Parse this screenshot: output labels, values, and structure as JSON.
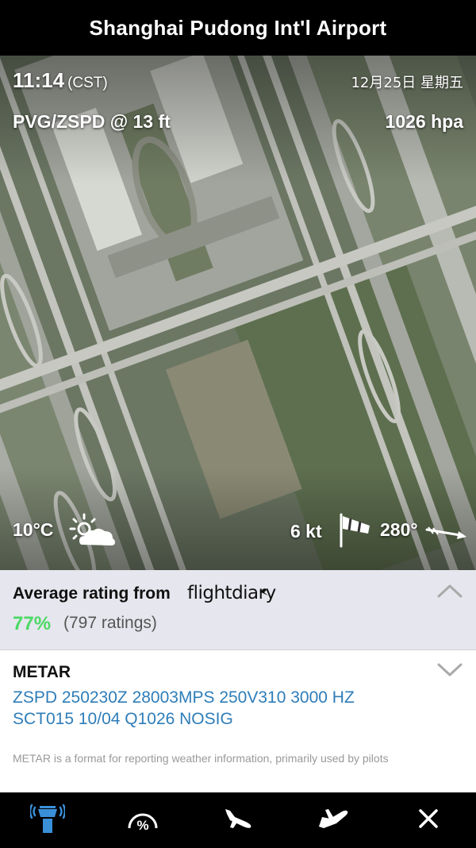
{
  "header": {
    "title": "Shanghai Pudong Int'l Airport"
  },
  "overlay": {
    "time": "11:14",
    "timezone": "(CST)",
    "date": "12月25日 星期五",
    "code": "PVG/ZSPD  @ 13 ft",
    "pressure": "1026 hpa",
    "temperature": "10°C",
    "weather_icon": "partly-cloudy-icon",
    "wind_speed": "6 kt",
    "wind_direction": "280°",
    "wind_icon": "windsock-icon"
  },
  "rating": {
    "heading": "Average rating from",
    "brand": "flightdiary",
    "percent": "77%",
    "count": "(797 ratings)",
    "toggle_icon": "chevron-up-icon"
  },
  "metar": {
    "heading": "METAR",
    "line1": "ZSPD 250230Z 28003MPS 250V310 3000 HZ",
    "line2": "SCT015 10/04 Q1026 NOSIG",
    "note": "METAR is a format for reporting weather information, primarily used by pilots",
    "toggle_icon": "chevron-down-icon"
  },
  "tabbar": {
    "tabs": [
      {
        "icon": "control-tower-icon",
        "active": true
      },
      {
        "icon": "percent-gauge-icon",
        "active": false
      },
      {
        "icon": "arrivals-icon",
        "active": false
      },
      {
        "icon": "departures-icon",
        "active": false
      },
      {
        "icon": "close-icon",
        "active": false
      }
    ]
  },
  "colors": {
    "accent_blue": "#3a8fd9",
    "rating_green": "#4cd964",
    "metar_blue": "#2e7db8",
    "rating_bg": "#e6e6ee"
  }
}
